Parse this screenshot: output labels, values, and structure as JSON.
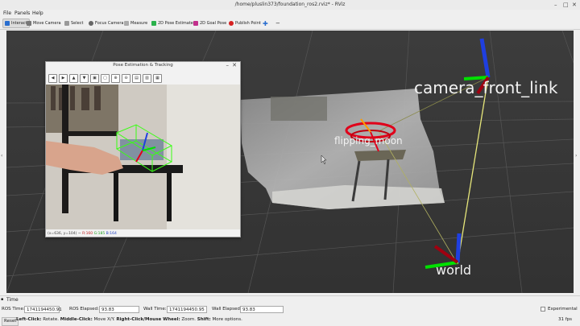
{
  "window": {
    "title": "/home/pluslin373/foundation_ros2.rviz* - RViz"
  },
  "menu": {
    "file": "File",
    "panels": "Panels",
    "help": "Help"
  },
  "toolbar": {
    "interact": "Interact",
    "move_camera": "Move Camera",
    "select": "Select",
    "focus_camera": "Focus Camera",
    "measure": "Measure",
    "pose_estimate": "2D Pose Estimate",
    "goal_pose": "2D Goal Pose",
    "publish_point": "Publish Point"
  },
  "scene": {
    "camera_frame": "camera_front_link",
    "object_frame": "flipping_moon",
    "world_frame": "world"
  },
  "image_window": {
    "title": "Pose Estimation & Tracking",
    "status_prefix": "(x=636, y=104) ~ ",
    "r": "R:160",
    "g": "G:185",
    "b": "B:164"
  },
  "time_panel": {
    "header": "Time",
    "ros_time_label": "ROS Time:",
    "ros_time_value": "1741194450.91",
    "ros_elapsed_label": "ROS Elapsed:",
    "ros_elapsed_value": "93.83",
    "wall_time_label": "Wall Time:",
    "wall_time_value": "1741194450.95",
    "wall_elapsed_label": "Wall Elapsed:",
    "wall_elapsed_value": "93.83",
    "experimental": "Experimental"
  },
  "status_bar": {
    "reset": "Reset",
    "hint_left_key": "Left-Click:",
    "hint_left": " Rotate.",
    "hint_mid_key": "Middle-Click:",
    "hint_mid": " Move X/Y.",
    "hint_right_key": "Right-Click/Mouse Wheel:",
    "hint_right": " Zoom.",
    "hint_shift_key": "Shift:",
    "hint_shift": " More options.",
    "fps": "31 fps"
  },
  "colors": {
    "x_axis": "#e0001a",
    "y_axis": "#00e000",
    "z_axis": "#1f3fe0",
    "tf_link": "#e0e060",
    "bbox": "#39ff14"
  }
}
